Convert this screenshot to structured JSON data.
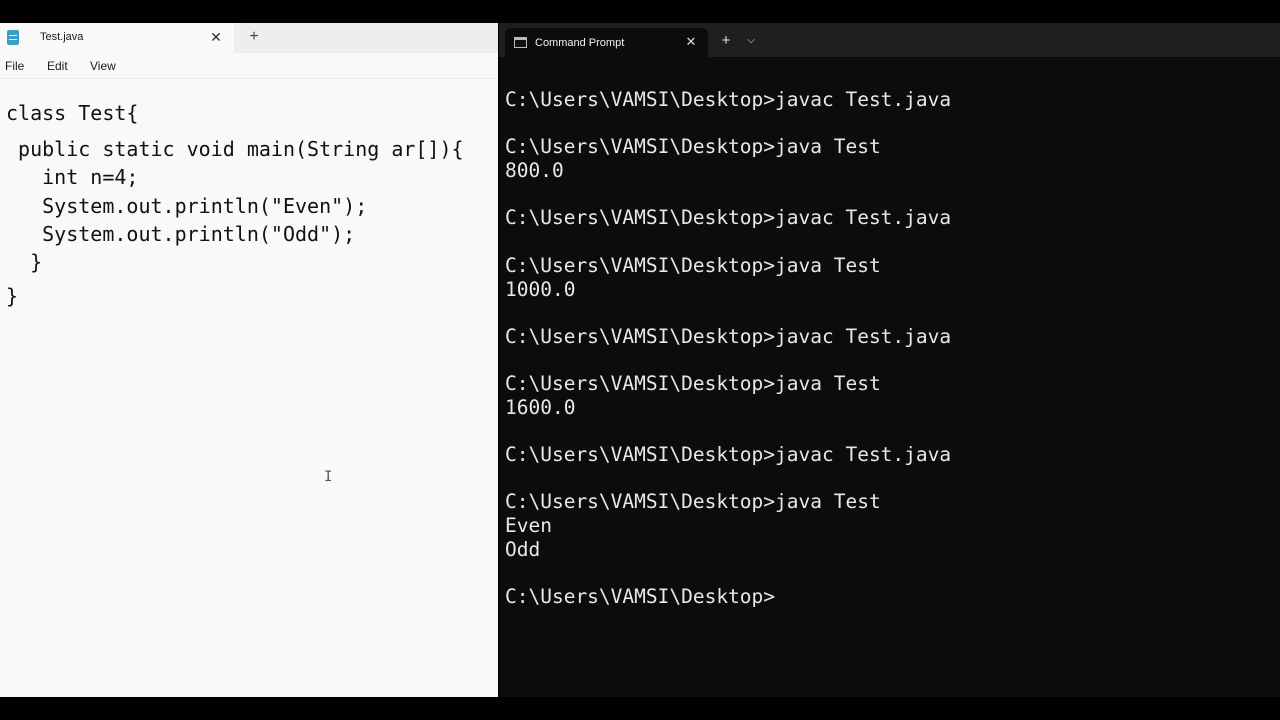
{
  "notepad": {
    "tab_title": "Test.java",
    "tab_close": "✕",
    "new_tab": "+",
    "menu": [
      "File",
      "Edit",
      "View"
    ],
    "code_lines": [
      "class Test{",
      " public static void main(String ar[]){",
      "   int n=4;",
      "   System.out.println(\"Even\");",
      "   System.out.println(\"Odd\");",
      "  }",
      "}"
    ],
    "text_cursor": "I"
  },
  "terminal": {
    "tab_title": "Command Prompt",
    "tab_close": "✕",
    "new_tab": "+",
    "dropdown": "⌵",
    "lines": [
      "C:\\Users\\VAMSI\\Desktop>javac Test.java",
      "C:\\Users\\VAMSI\\Desktop>java Test",
      "800.0",
      "C:\\Users\\VAMSI\\Desktop>javac Test.java",
      "C:\\Users\\VAMSI\\Desktop>java Test",
      "1000.0",
      "C:\\Users\\VAMSI\\Desktop>javac Test.java",
      "C:\\Users\\VAMSI\\Desktop>java Test",
      "1600.0",
      "C:\\Users\\VAMSI\\Desktop>javac Test.java",
      "C:\\Users\\VAMSI\\Desktop>java Test",
      "Even",
      "Odd",
      "C:\\Users\\VAMSI\\Desktop>"
    ]
  }
}
